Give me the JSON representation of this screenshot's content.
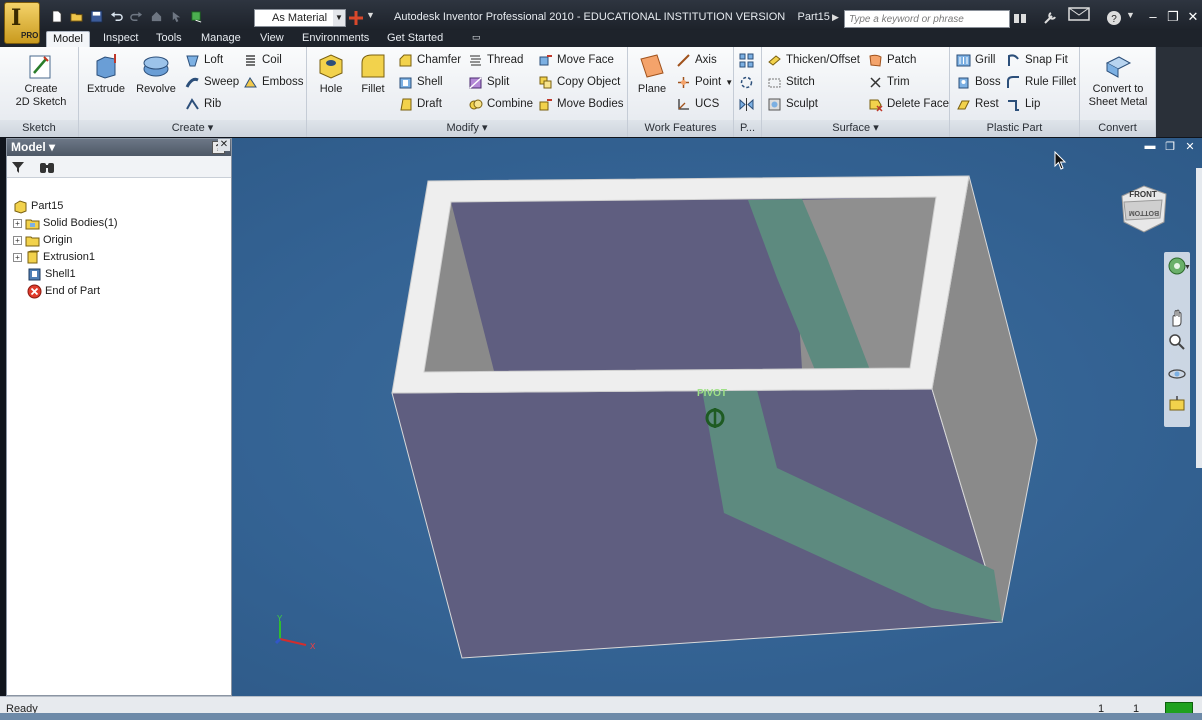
{
  "app": {
    "title": "Autodesk Inventor Professional 2010 - EDUCATIONAL INSTITUTION VERSION",
    "document": "Part15",
    "app_button_label": "PRO",
    "material": "As Material",
    "search_placeholder": "Type a keyword or phrase"
  },
  "tabs": [
    "Model",
    "Inspect",
    "Tools",
    "Manage",
    "View",
    "Environments",
    "Get Started"
  ],
  "ribbon": {
    "sketch": {
      "create_label": "Create",
      "create_label2": "2D Sketch",
      "footer": "Sketch"
    },
    "create": {
      "extrude": "Extrude",
      "revolve": "Revolve",
      "loft": "Loft",
      "coil": "Coil",
      "sweep": "Sweep",
      "emboss": "Emboss",
      "rib": "Rib",
      "footer": "Create"
    },
    "modify": {
      "hole": "Hole",
      "fillet": "Fillet",
      "chamfer": "Chamfer",
      "thread": "Thread",
      "move_face": "Move Face",
      "shell": "Shell",
      "split": "Split",
      "copy_object": "Copy Object",
      "draft": "Draft",
      "combine": "Combine",
      "move_bodies": "Move Bodies",
      "footer": "Modify"
    },
    "work": {
      "plane": "Plane",
      "axis": "Axis",
      "point": "Point",
      "ucs": "UCS",
      "footer": "Work Features"
    },
    "p": {
      "footer": "P..."
    },
    "surface": {
      "thicken": "Thicken/Offset",
      "patch": "Patch",
      "stitch": "Stitch",
      "trim": "Trim",
      "sculpt": "Sculpt",
      "delete_face": "Delete Face",
      "footer": "Surface"
    },
    "plastic": {
      "grill": "Grill",
      "snap_fit": "Snap Fit",
      "boss": "Boss",
      "rule_fillet": "Rule Fillet",
      "rest": "Rest",
      "lip": "Lip",
      "footer": "Plastic Part"
    },
    "convert": {
      "label1": "Convert to",
      "label2": "Sheet Metal",
      "footer": "Convert"
    }
  },
  "browser": {
    "title": "Model",
    "help": "?",
    "tree": [
      {
        "label": "Part15",
        "icon": "part-icon"
      },
      {
        "label": "Solid Bodies(1)",
        "icon": "solid-bodies-icon"
      },
      {
        "label": "Origin",
        "icon": "folder-icon"
      },
      {
        "label": "Extrusion1",
        "icon": "extrusion-icon"
      },
      {
        "label": "Shell1",
        "icon": "shell-icon"
      },
      {
        "label": "End of Part",
        "icon": "end-of-part-icon"
      }
    ]
  },
  "viewport": {
    "pivot_label": "PIVOT",
    "viewcube_front": "FRONT",
    "viewcube_bottom": "BOTTOM",
    "triad_x": "X",
    "triad_y": "Y"
  },
  "status": {
    "text": "Ready",
    "count1": "1",
    "count2": "1"
  },
  "colors": {
    "viewport_bg": "#346394",
    "model_face": "#5f5e80",
    "model_side": "#8a8a8a",
    "model_rim": "#efefef",
    "highlight_band": "#5d8a7f",
    "ribbon_bg": "#eef1f5"
  }
}
